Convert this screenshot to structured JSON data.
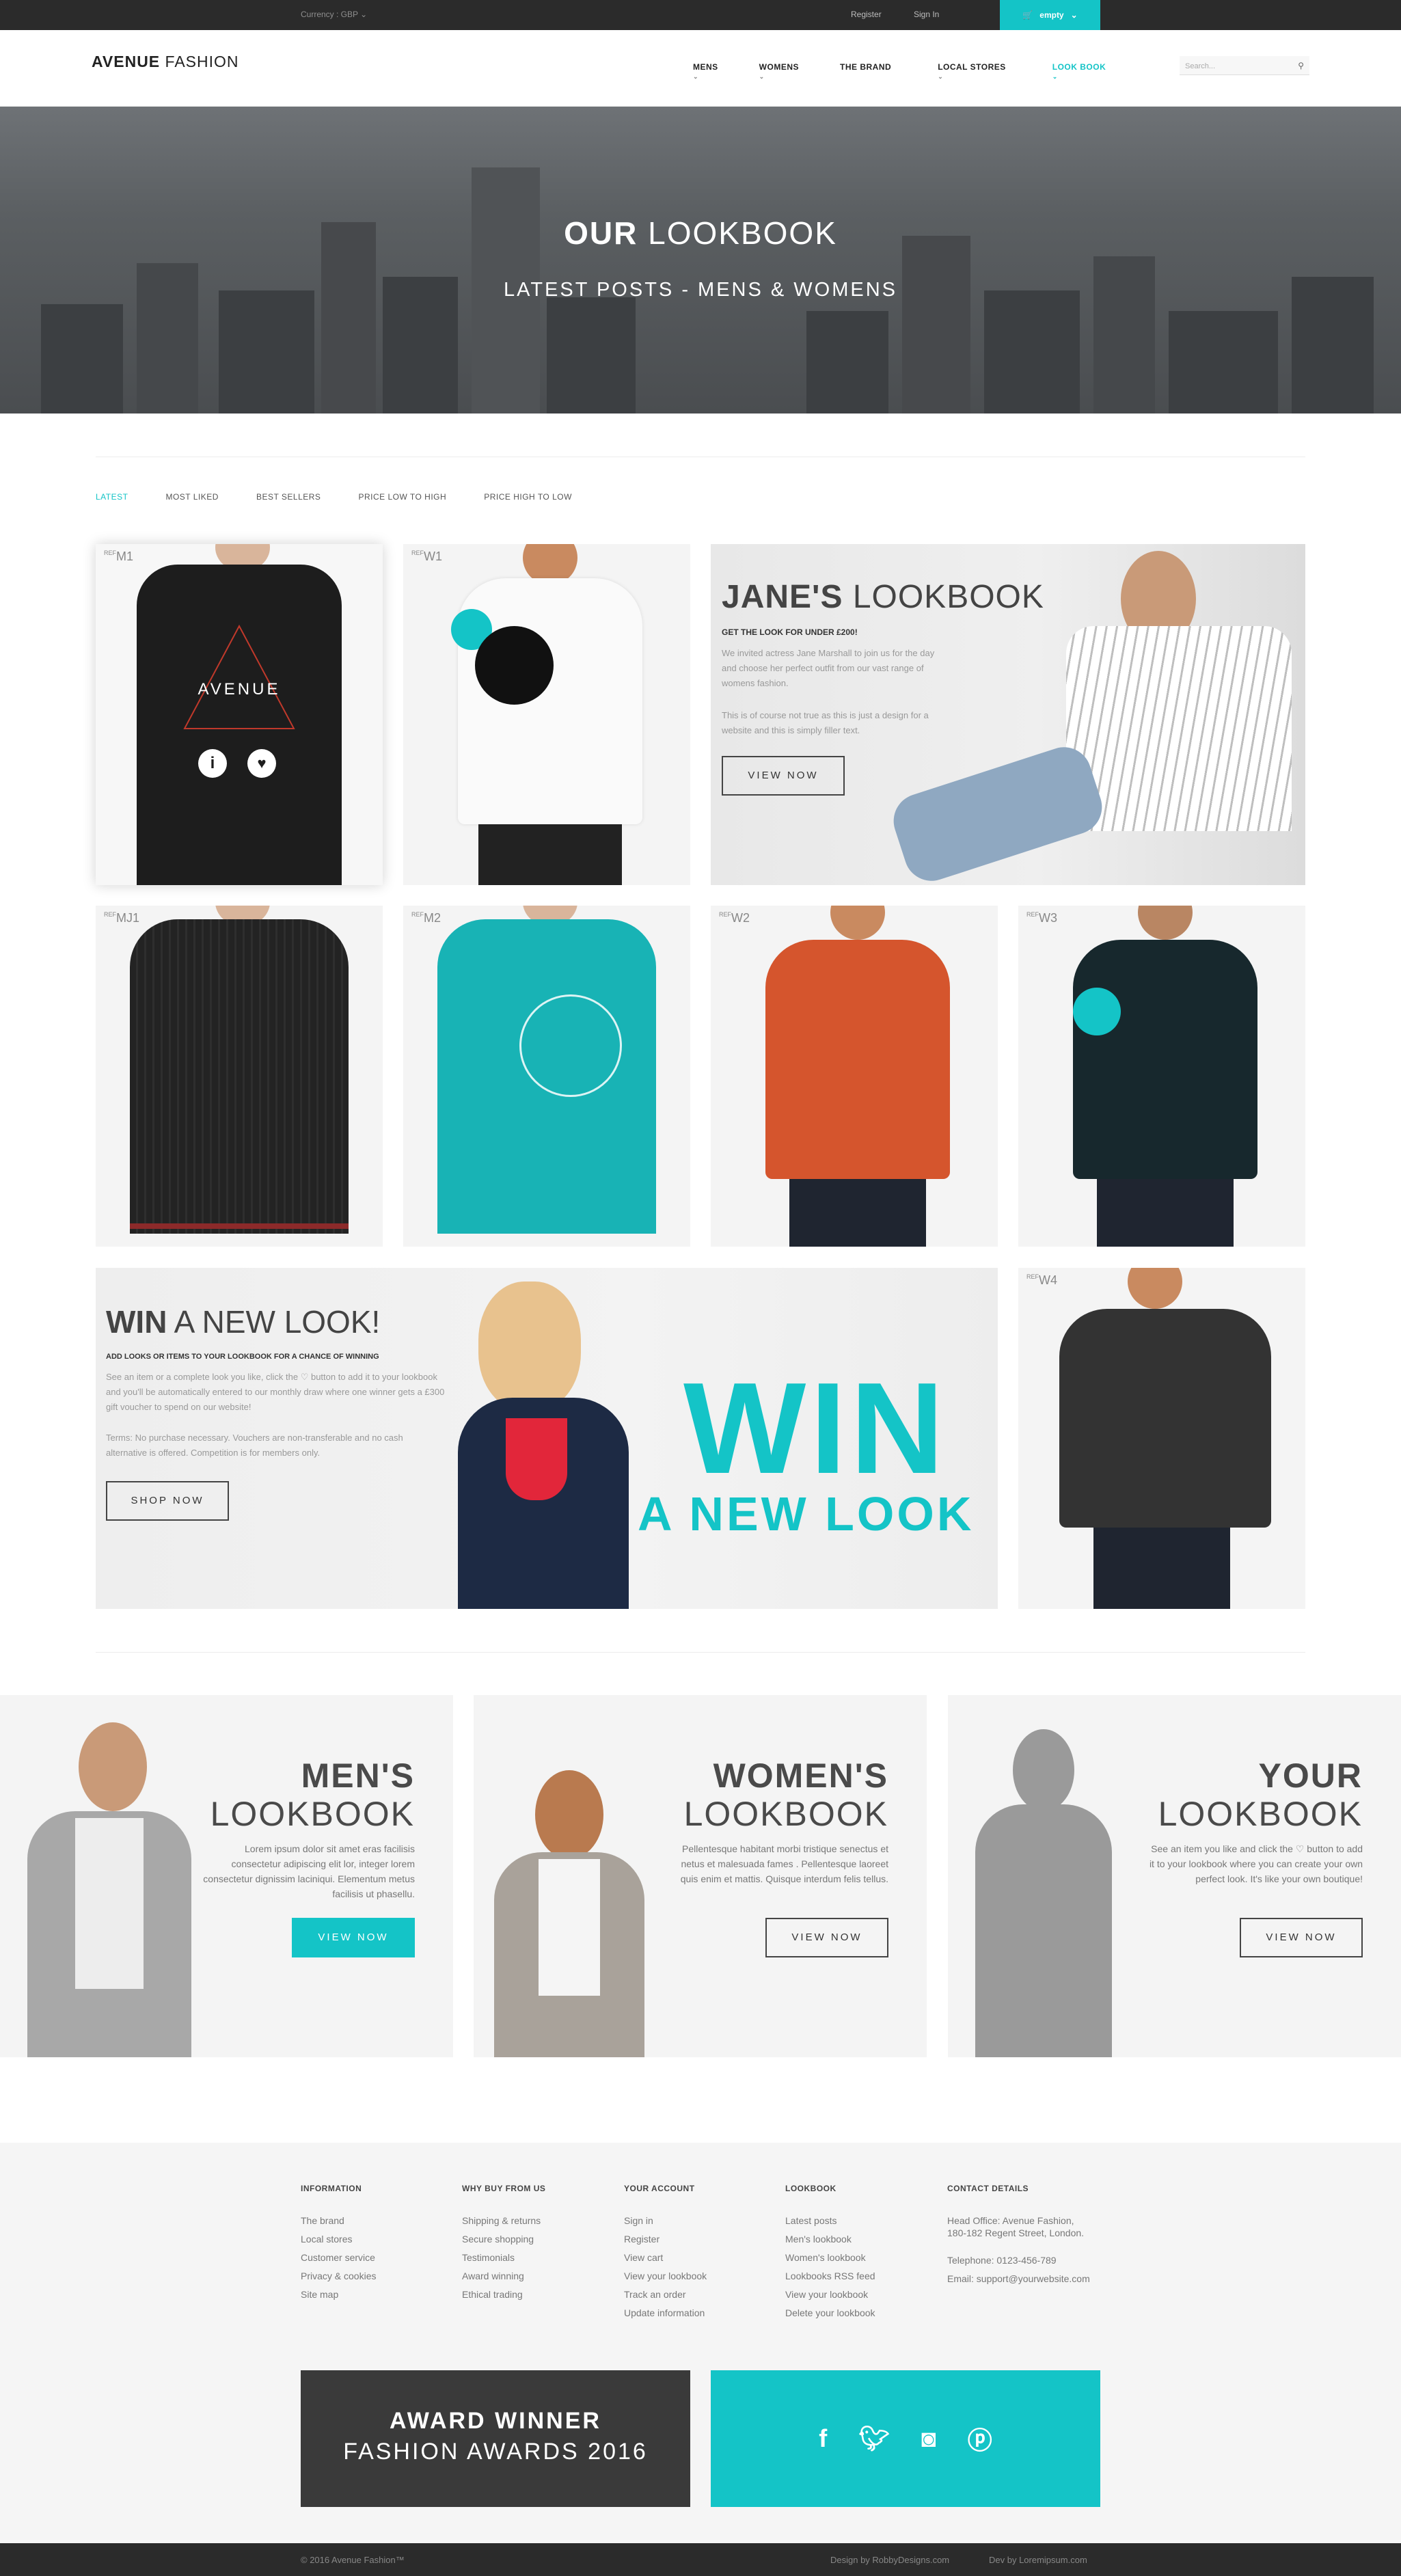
{
  "topbar": {
    "currency": "Currency : GBP",
    "register": "Register",
    "signin": "Sign In",
    "cart": "empty"
  },
  "header": {
    "logo_bold": "AVENUE",
    "logo_rest": "FASHION",
    "nav": [
      {
        "label": "MENS",
        "has_dropdown": true
      },
      {
        "label": "WOMENS",
        "has_dropdown": true
      },
      {
        "label": "THE BRAND",
        "has_dropdown": false
      },
      {
        "label": "LOCAL STORES",
        "has_dropdown": true
      },
      {
        "label": "LOOK BOOK",
        "has_dropdown": true,
        "active": true
      }
    ],
    "search_placeholder": "Search..."
  },
  "hero": {
    "title_bold": "OUR",
    "title_rest": "LOOKBOOK",
    "subtitle": "LATEST POSTS - MENS & WOMENS"
  },
  "filters": [
    "LATEST",
    "MOST LIKED",
    "BEST SELLERS",
    "PRICE LOW TO HIGH",
    "PRICE HIGH TO LOW"
  ],
  "products": [
    {
      "ref": "M1"
    },
    {
      "ref": "W1"
    },
    {
      "ref": "MJ1"
    },
    {
      "ref": "M2"
    },
    {
      "ref": "W2"
    },
    {
      "ref": "W3"
    },
    {
      "ref": "W4"
    }
  ],
  "ref_prefix": "REF",
  "jane": {
    "title_bold": "JANE'S",
    "title_rest": "LOOKBOOK",
    "subtitle": "GET THE LOOK FOR UNDER £200!",
    "p1": "We invited actress Jane Marshall to join us for the day and choose her perfect outfit from our vast range of womens fashion.",
    "p2": "This is of course not true as this is just a design for a website and this is simply filler text.",
    "button": "VIEW NOW"
  },
  "win": {
    "title_bold": "WIN",
    "title_rest": "A NEW LOOK!",
    "subtitle": "ADD LOOKS OR ITEMS TO YOUR LOOKBOOK FOR A CHANCE OF WINNING",
    "p1": "See an item or a complete look you like, click the ♡ button to add it to your lookbook and you'll be automatically entered to our monthly draw where one winner gets a £300 gift voucher to spend on our website!",
    "p2": "Terms: No purchase necessary. Vouchers are non-transferable and no cash alternative is offered. Competition is for members only.",
    "button": "SHOP NOW",
    "big_win": "WIN",
    "big_line2": "A NEW LOOK"
  },
  "lookbooks": [
    {
      "title_bold": "MEN'S",
      "title_rest": "LOOKBOOK",
      "text": "Lorem ipsum dolor sit amet eras facilisis consectetur adipiscing elit lor, integer lorem consectetur dignissim laciniqui. Elementum metus facilisis ut phasellu.",
      "button": "VIEW NOW"
    },
    {
      "title_bold": "WOMEN'S",
      "title_rest": "LOOKBOOK",
      "text": "Pellentesque habitant morbi tristique senectus et netus et malesuada fames . Pellentesque laoreet quis enim et mattis. Quisque interdum felis tellus.",
      "button": "VIEW NOW"
    },
    {
      "title_bold": "YOUR",
      "title_rest": "LOOKBOOK",
      "text": "See an item you like and click the ♡ button to add it to your lookbook where you can create your own perfect look. It's like your own boutique!",
      "button": "VIEW NOW"
    }
  ],
  "footer": {
    "columns": [
      {
        "heading": "INFORMATION",
        "items": [
          "The brand",
          "Local stores",
          "Customer service",
          "Privacy & cookies",
          "Site map"
        ]
      },
      {
        "heading": "WHY BUY FROM US",
        "items": [
          "Shipping & returns",
          "Secure shopping",
          "Testimonials",
          "Award winning",
          "Ethical trading"
        ]
      },
      {
        "heading": "YOUR ACCOUNT",
        "items": [
          "Sign in",
          "Register",
          "View cart",
          "View your lookbook",
          "Track an order",
          "Update information"
        ]
      },
      {
        "heading": "LOOKBOOK",
        "items": [
          "Latest posts",
          "Men's lookbook",
          "Women's lookbook",
          "Lookbooks RSS feed",
          "View your lookbook",
          "Delete your lookbook"
        ]
      },
      {
        "heading": "CONTACT DETAILS",
        "items": [
          "Head Office: Avenue Fashion,",
          "180-182 Regent Street, London.",
          "",
          "Telephone: 0123-456-789",
          "Email: support@yourwebsite.com"
        ]
      }
    ],
    "award_line1": "AWARD WINNER",
    "award_line2": "FASHION AWARDS 2016",
    "social": [
      "facebook-icon",
      "twitter-icon",
      "instagram-icon",
      "pinterest-icon"
    ],
    "copyright": "© 2016 Avenue Fashion™",
    "design_by": "Design by RobbyDesigns.com",
    "dev_by": "Dev by Loremipsum.com"
  },
  "colors": {
    "accent": "#14c4c7",
    "dark": "#2b2b2b",
    "tile": "#f4f4f4"
  }
}
